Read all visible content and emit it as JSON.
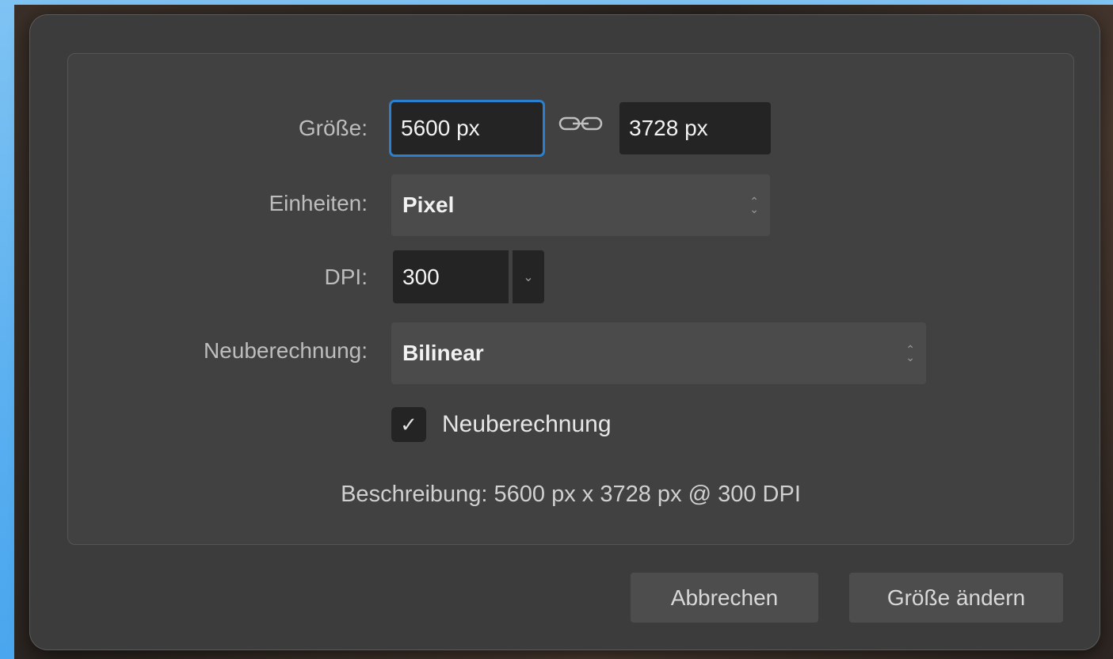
{
  "dialog": {
    "size_label": "Größe:",
    "width_value": "5600 px",
    "height_value": "3728 px",
    "units_label": "Einheiten:",
    "units_value": "Pixel",
    "dpi_label": "DPI:",
    "dpi_value": "300",
    "resample_label": "Neuberechnung:",
    "resample_value": "Bilinear",
    "resample_checkbox_label": "Neuberechnung",
    "resample_checked": true,
    "description": "Beschreibung: 5600 px x 3728 px @ 300 DPI",
    "cancel_label": "Abbrechen",
    "resize_label": "Größe ändern"
  },
  "icons": {
    "link": "link-icon",
    "check": "checkmark-icon",
    "updown": "chevron-updown-icon",
    "dropdown": "chevron-down-icon"
  },
  "colors": {
    "focus": "#2a7fd0",
    "dialog_bg": "#3c3c3c",
    "field_bg": "#242424"
  }
}
